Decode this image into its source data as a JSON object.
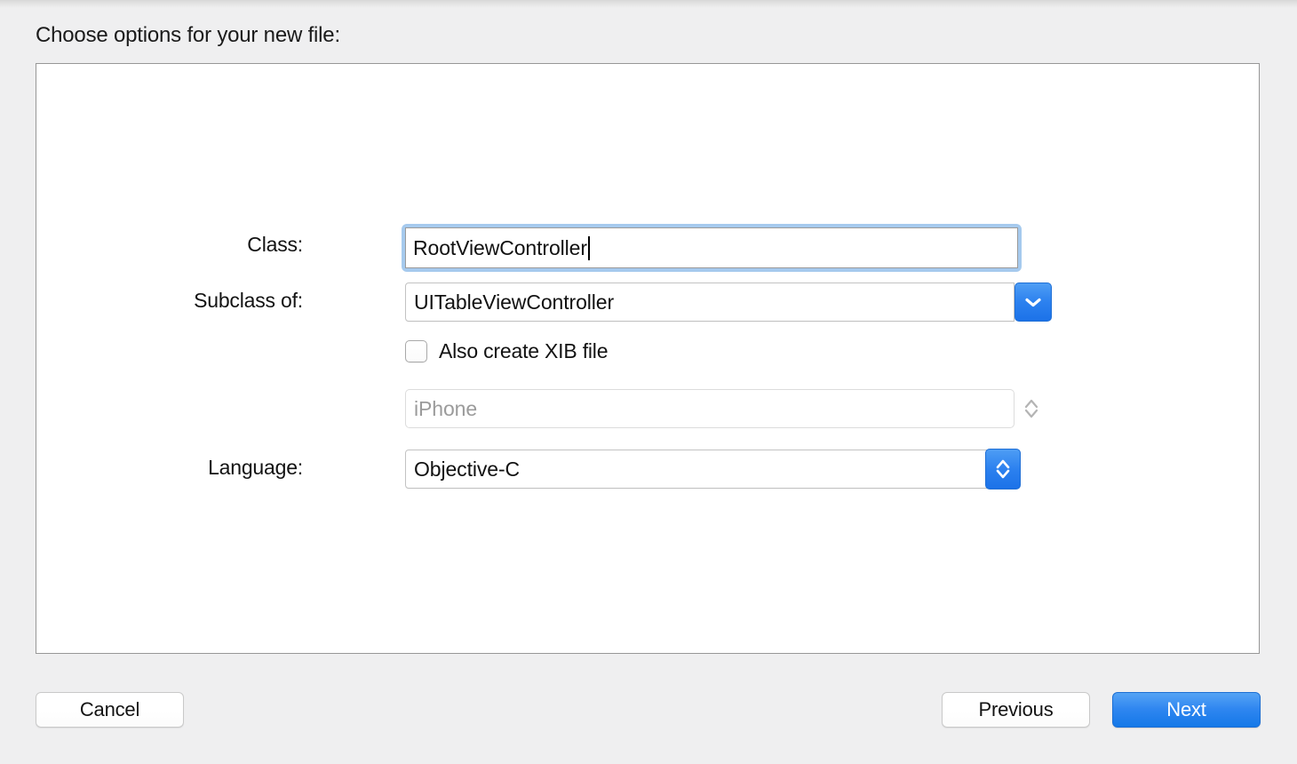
{
  "dialog": {
    "title": "Choose options for your new file:"
  },
  "form": {
    "class": {
      "label": "Class:",
      "value": "RootViewController",
      "placeholder": "",
      "focused": true
    },
    "subclass": {
      "label": "Subclass of:",
      "value": "UITableViewController",
      "icon": "chevron-down-icon"
    },
    "xib": {
      "label": "Also create XIB file",
      "checked": false
    },
    "device": {
      "value": "iPhone",
      "enabled": false,
      "icon": "stepper-chevrons-icon"
    },
    "language": {
      "label": "Language:",
      "value": "Objective-C",
      "icon": "stepper-chevrons-icon"
    }
  },
  "buttons": {
    "cancel": "Cancel",
    "previous": "Previous",
    "next": "Next"
  },
  "colors": {
    "accent_blue": "#2f86f0",
    "focus_ring": "#a6caee",
    "background": "#efeff0",
    "panel": "#ffffff",
    "panel_border": "#979797",
    "disabled_text": "#9b9b9b"
  }
}
